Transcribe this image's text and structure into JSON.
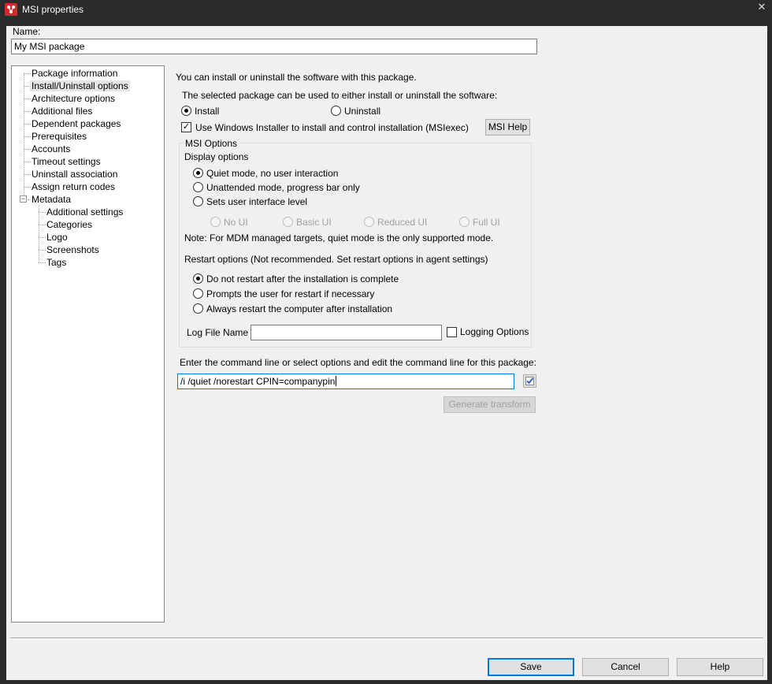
{
  "window": {
    "title": "MSI properties"
  },
  "name_field": {
    "label": "Name:",
    "value": "My MSI package"
  },
  "tree": {
    "items": [
      "Package information",
      "Install/Uninstall options",
      "Architecture options",
      "Additional files",
      "Dependent packages",
      "Prerequisites",
      "Accounts",
      "Timeout settings",
      "Uninstall association",
      "Assign return codes",
      "Metadata"
    ],
    "metadata_children": [
      "Additional settings",
      "Categories",
      "Logo",
      "Screenshots",
      "Tags"
    ],
    "expander_symbol": "−"
  },
  "main": {
    "intro": "You can install or uninstall the software with this package.",
    "mode_prompt": "The selected package can be used to either install or uninstall the software:",
    "install_label": "Install",
    "uninstall_label": "Uninstall",
    "use_msiexec_label": "Use Windows Installer to install and control installation (MSIexec)",
    "msi_help_label": "MSI Help",
    "msi_options": {
      "title": "MSI Options",
      "display_title": "Display options",
      "quiet_label": "Quiet mode, no user interaction",
      "unattended_label": "Unattended mode, progress bar only",
      "ui_level_label": "Sets user interface level",
      "no_ui": "No UI",
      "basic_ui": "Basic UI",
      "reduced_ui": "Reduced UI",
      "full_ui": "Full UI",
      "note": "Note: For MDM managed targets, quiet mode is the only supported mode.",
      "restart_title": "Restart options (Not recommended. Set restart options in agent settings)",
      "no_restart": "Do not restart after the installation is complete",
      "prompt_restart": "Prompts the user for restart if necessary",
      "always_restart": "Always restart the computer after installation",
      "log_file_label": "Log File Name",
      "log_file_value": "",
      "logging_options_label": "Logging Options"
    },
    "cmdline_prompt": "Enter the command line or select options and edit the command line for this package:",
    "cmdline_value": "/i /quiet /norestart CPIN=companypin",
    "generate_transform_label": "Generate transform"
  },
  "footer": {
    "save_label": "Save",
    "cancel_label": "Cancel",
    "help_label": "Help"
  },
  "colors": {
    "accent": "#0078d7",
    "app_icon": "#d42a2a"
  }
}
